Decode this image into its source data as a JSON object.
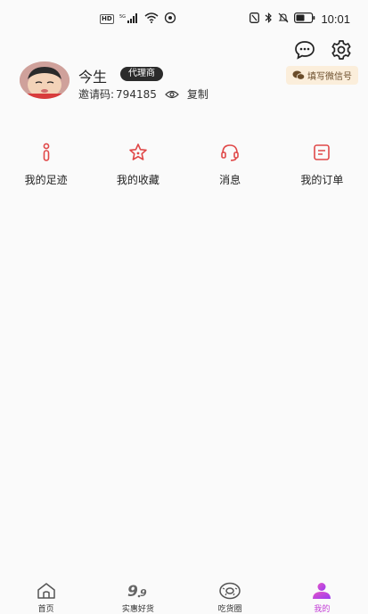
{
  "status_bar": {
    "hd": "HD",
    "network": "5G",
    "time": "10:01"
  },
  "profile": {
    "username": "今生",
    "role": "代理商",
    "invite_label": "邀请码:",
    "invite_code": "794185",
    "copy_label": "复制",
    "wechat_button": "填写微信号"
  },
  "menu": [
    {
      "label": "我的足迹",
      "icon": "footprint-icon"
    },
    {
      "label": "我的收藏",
      "icon": "star-icon"
    },
    {
      "label": "消息",
      "icon": "headset-icon"
    },
    {
      "label": "我的订单",
      "icon": "order-icon"
    }
  ],
  "tabs": [
    {
      "label": "首页",
      "icon": "home-icon",
      "active": false
    },
    {
      "label": "实惠好货",
      "icon": "nine-nine-icon",
      "active": false
    },
    {
      "label": "吃货圈",
      "icon": "donut-icon",
      "active": false
    },
    {
      "label": "我的",
      "icon": "person-icon",
      "active": true
    }
  ],
  "colors": {
    "accent": "#c23bd6",
    "menu_icon": "#e04848",
    "wechat_bg": "#fbeedb"
  }
}
